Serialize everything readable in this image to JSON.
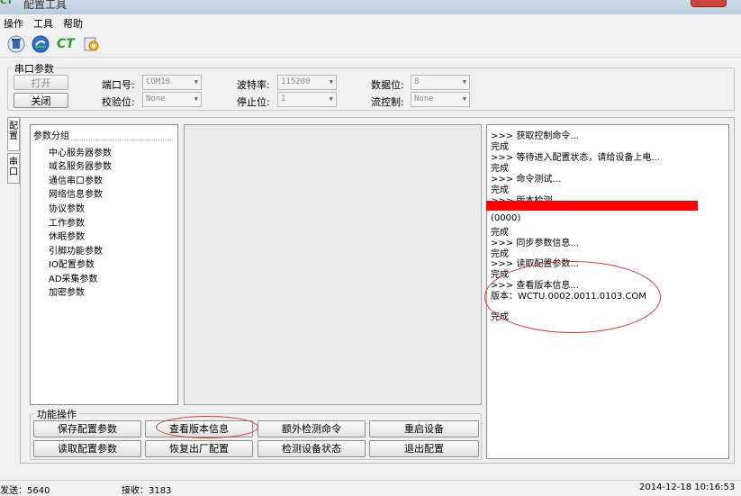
{
  "window": {
    "title": "配置工具"
  },
  "menu": {
    "items": [
      "操作",
      "工具",
      "帮助"
    ]
  },
  "toolbar": {
    "icons": [
      "trash-icon",
      "refresh-icon",
      "ct-icon",
      "settings-icon"
    ],
    "ct_label": "CT"
  },
  "serial": {
    "group_title": "串口参数",
    "open_label": "打开",
    "close_label": "关闭",
    "port_label": "端口号:",
    "port_value": "COM10",
    "baud_label": "波特率:",
    "baud_value": "115200",
    "databits_label": "数据位:",
    "databits_value": "8",
    "parity_label": "校验位:",
    "parity_value": "None",
    "stopbits_label": "停止位:",
    "stopbits_value": "1",
    "flow_label": "流控制:",
    "flow_value": "None"
  },
  "side_tabs": [
    "配置",
    "串口"
  ],
  "params": {
    "root": "参数分组",
    "items": [
      "中心服务器参数",
      "域名服务器参数",
      "通信串口参数",
      "网络信息参数",
      "协议参数",
      "工作参数",
      "休眠参数",
      "引脚功能参数",
      "IO配置参数",
      "AD采集参数",
      "加密参数"
    ]
  },
  "functions": {
    "group_title": "功能操作",
    "buttons": [
      "保存配置参数",
      "查看版本信息",
      "额外检测命令",
      "重启设备",
      "读取配置参数",
      "恢复出厂配置",
      "检测设备状态",
      "退出配置"
    ]
  },
  "log": {
    "lines": [
      ">>> 获取控制命令...",
      "完成",
      ">>> 等待进入配置状态，请给设备上电...",
      "完成",
      ">>> 命令测试...",
      "完成",
      ">>> 版本检测...",
      "",
      "(0000)",
      "完成",
      ">>> 同步参数信息...",
      "完成",
      ">>> 读取配置参数...",
      "完成",
      ">>> 查看版本信息...",
      "版本：WCTU.0002.0011.0103.COM",
      "",
      "完成"
    ]
  },
  "status": {
    "sent": "发送：5640",
    "received": "接收：3183",
    "datetime": "2014-12-18 10:16:53"
  }
}
